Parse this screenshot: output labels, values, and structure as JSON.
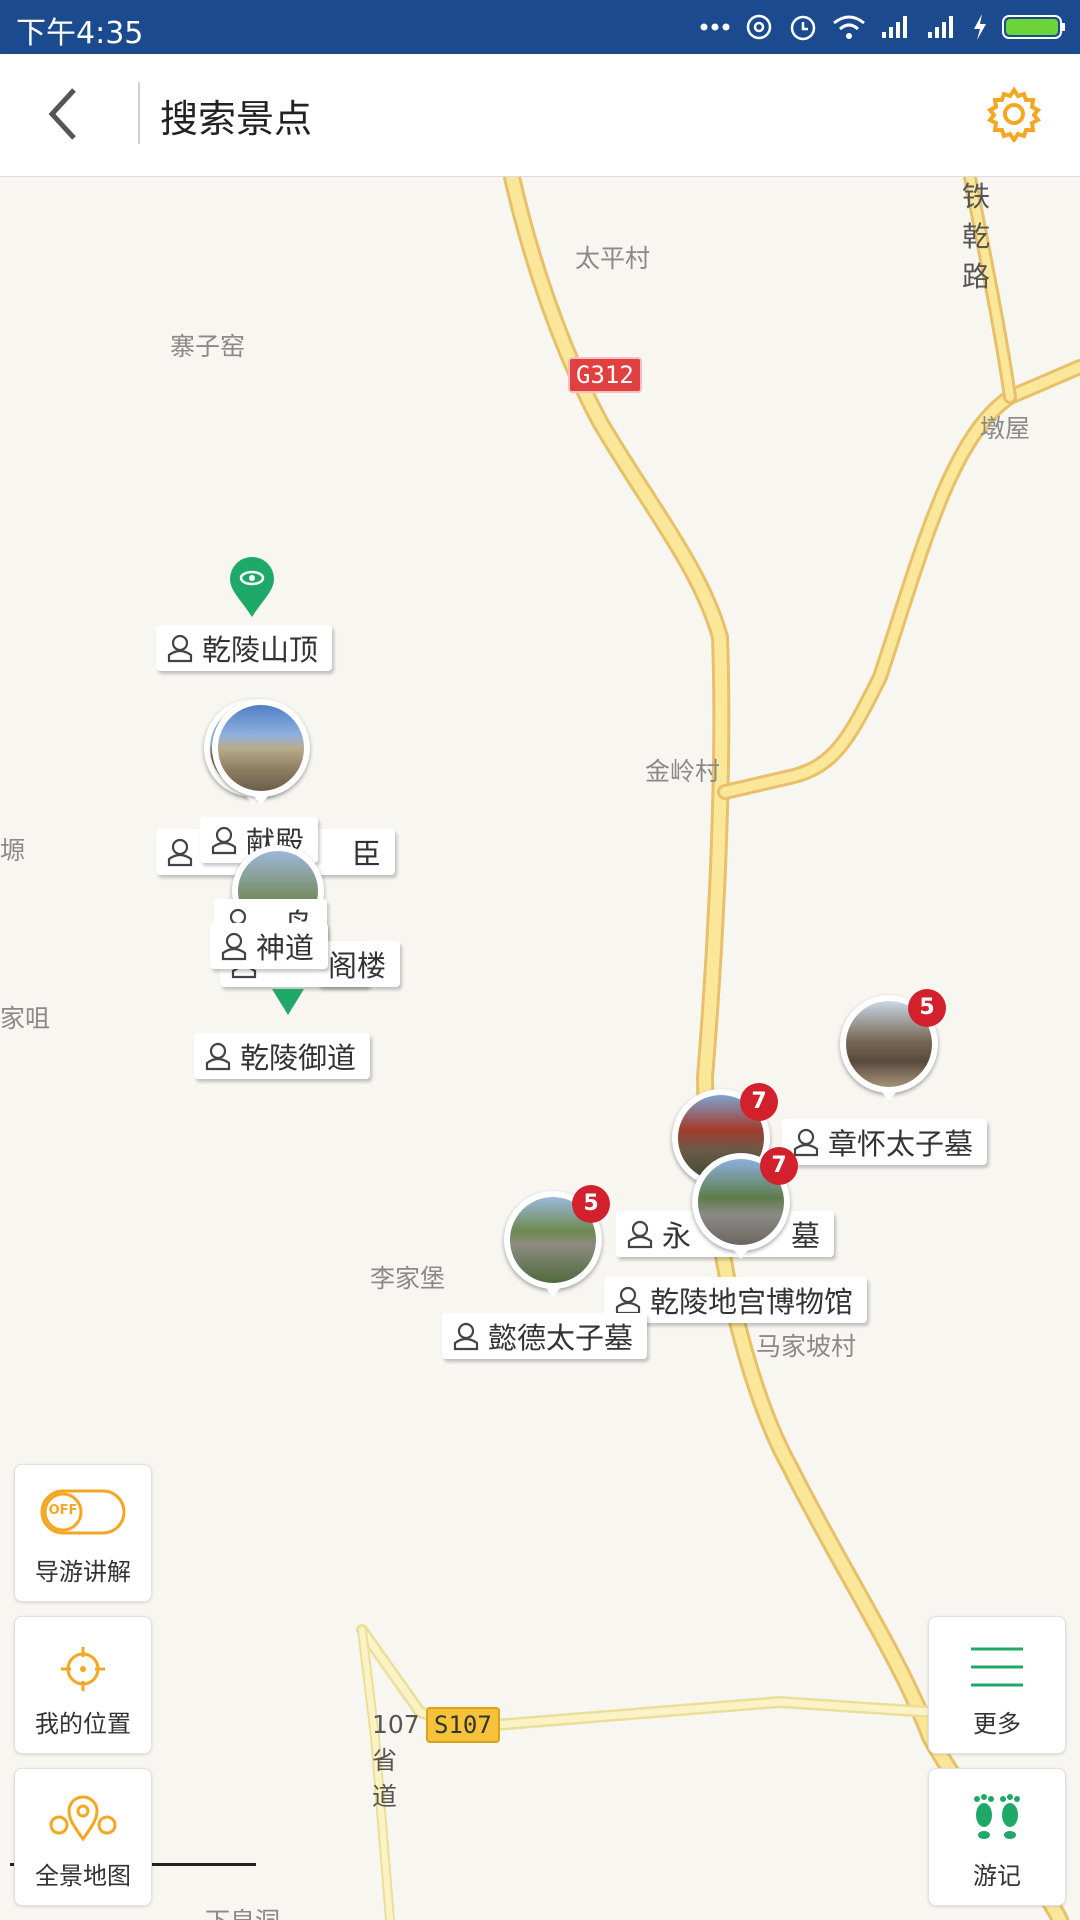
{
  "status_bar": {
    "time": "下午4:35"
  },
  "header": {
    "back_icon": "chevron-left-icon",
    "title": "搜索景点",
    "settings_icon": "gear-icon",
    "accent_color": "#f5a623"
  },
  "map": {
    "places": {
      "zhaizi": "寨子窑",
      "taiping": "太平村",
      "dunwu": "墩屋",
      "tieqian": "铁乾路",
      "jinling": "金岭村",
      "yuan": "塬",
      "jiazan": "家咀",
      "lijiabao": "李家堡",
      "majiapo": "马家坡村",
      "road107": "107省道",
      "bottom": "下皇洞"
    },
    "road_shields": {
      "g312": "G312",
      "s107": "S107"
    },
    "scenic_labels": {
      "qianling_top": "乾陵山顶",
      "xiandian": "献殿",
      "chen": "臣",
      "niao": "鸟",
      "shendao": "神道",
      "gelou": "阁楼",
      "yuma": "马",
      "yudao": "乾陵御道",
      "zhanghuai": "章怀太子墓",
      "yongtai": "永",
      "yongtai_tail": "墓",
      "museum": "乾陵地宫博物馆",
      "yide": "懿德太子墓"
    },
    "badges": {
      "zhanghuai": "5",
      "cluster_a": "7",
      "cluster_b": "7",
      "yide": "5"
    }
  },
  "controls": {
    "guide_toggle": {
      "state": "OFF",
      "label": "导游讲解"
    },
    "locate": {
      "label": "我的位置"
    },
    "panorama": {
      "label": "全景地图"
    },
    "more": {
      "label": "更多"
    },
    "travel_log": {
      "label": "游记"
    }
  }
}
